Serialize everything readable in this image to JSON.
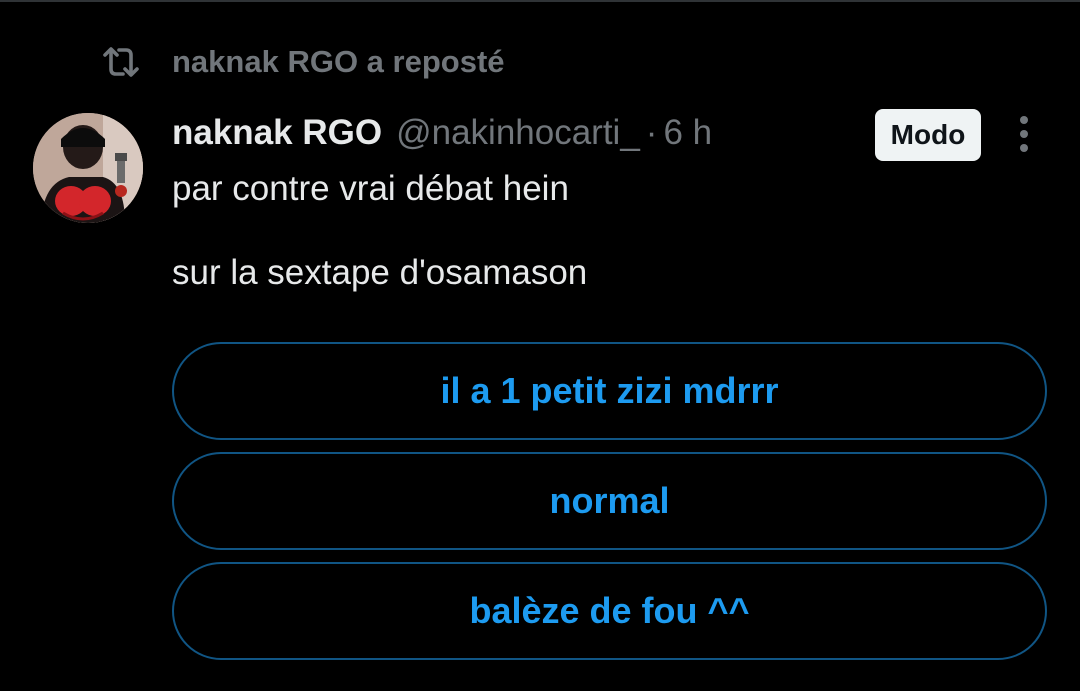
{
  "repost": {
    "icon": "repost-icon",
    "text": "naknak RGO a reposté"
  },
  "tweet": {
    "author": {
      "display_name": "naknak RGO",
      "handle": "@nakinhocarti_",
      "separator": "·",
      "time": "6 h",
      "avatar": "avatar-image"
    },
    "badge": "Modo",
    "more_icon": "more-vertical-icon",
    "text_lines": [
      "par contre vrai débat hein",
      "",
      "sur la sextape d'osamason"
    ],
    "poll": {
      "options": [
        {
          "label": "il a 1 petit zizi mdrrr"
        },
        {
          "label": "normal"
        },
        {
          "label": "balèze de fou ^^"
        }
      ]
    }
  },
  "colors": {
    "background": "#000000",
    "primary_text": "#e7e9ea",
    "secondary_text": "#71767b",
    "accent": "#1d9bf0",
    "badge_bg": "#eff3f4"
  }
}
